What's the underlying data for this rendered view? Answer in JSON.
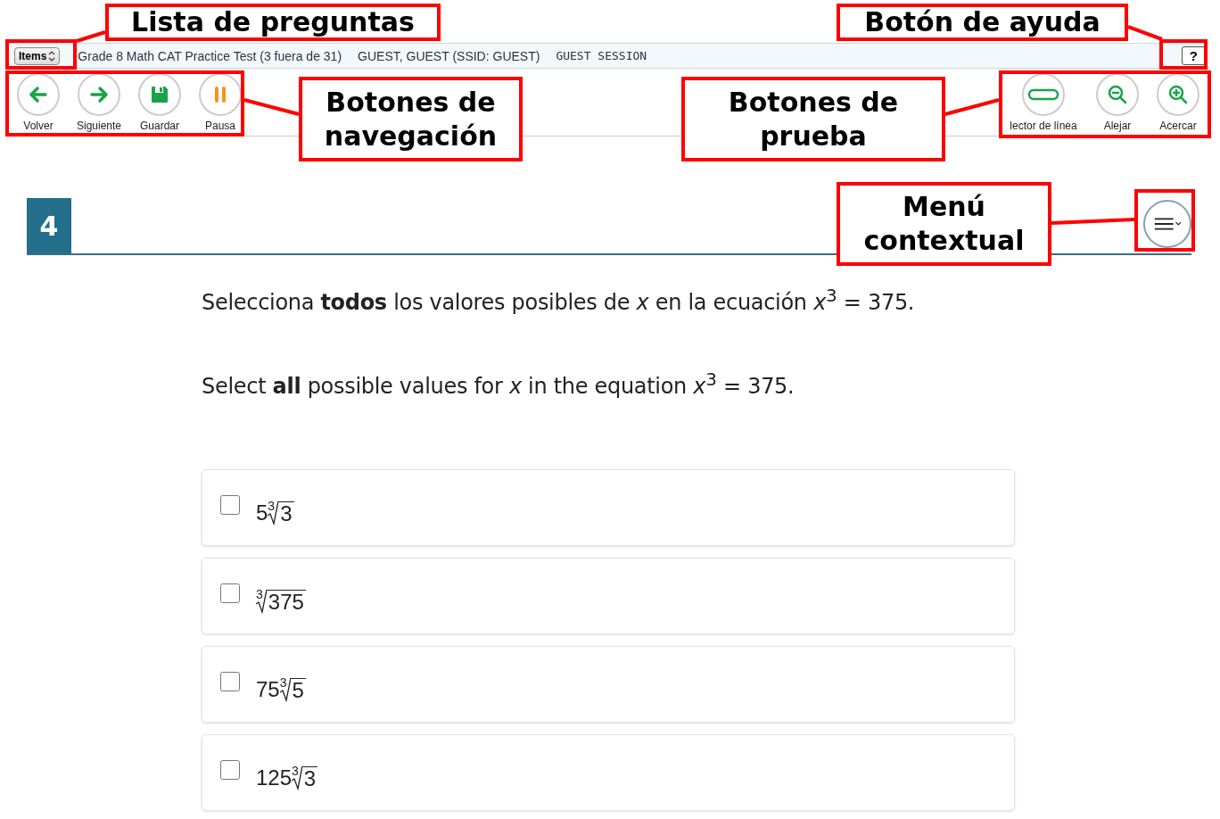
{
  "header": {
    "items_button": "Items",
    "test_title": "Grade 8 Math CAT Practice Test (3 fuera de 31)",
    "user": "GUEST, GUEST (SSID: GUEST)",
    "session": "GUEST SESSION",
    "help_button": "?"
  },
  "nav_buttons": [
    {
      "label": "Volver",
      "kind": "back"
    },
    {
      "label": "Siguiente",
      "kind": "next"
    },
    {
      "label": "Guardar",
      "kind": "save"
    },
    {
      "label": "Pausa",
      "kind": "pause"
    }
  ],
  "tool_buttons": [
    {
      "label": "lector de línea",
      "kind": "line-reader"
    },
    {
      "label": "Alejar",
      "kind": "zoom-out"
    },
    {
      "label": "Acercar",
      "kind": "zoom-in"
    }
  ],
  "question": {
    "number": "4",
    "prompts": [
      "Selecciona **todos** los valores posibles de *x* en la ecuación *x*$^{3}$ = 375.",
      "Select **all** possible values for *x* in the equation *x*$^{3}$ = 375."
    ],
    "options": [
      {
        "coefficient": "5",
        "index": "3",
        "radicand": "3",
        "checked": false
      },
      {
        "index": "3",
        "radicand": "375",
        "checked": false
      },
      {
        "coefficient": "75",
        "index": "3",
        "radicand": "5",
        "checked": false
      },
      {
        "coefficient": "125",
        "index": "3",
        "radicand": "3",
        "checked": false
      }
    ]
  },
  "annotations": [
    {
      "text": "Lista de preguntas"
    },
    {
      "text": "Botones de navegación"
    },
    {
      "text": "Botón de ayuda"
    },
    {
      "text": "Botones de prueba"
    },
    {
      "text": "Menú contextual"
    }
  ]
}
